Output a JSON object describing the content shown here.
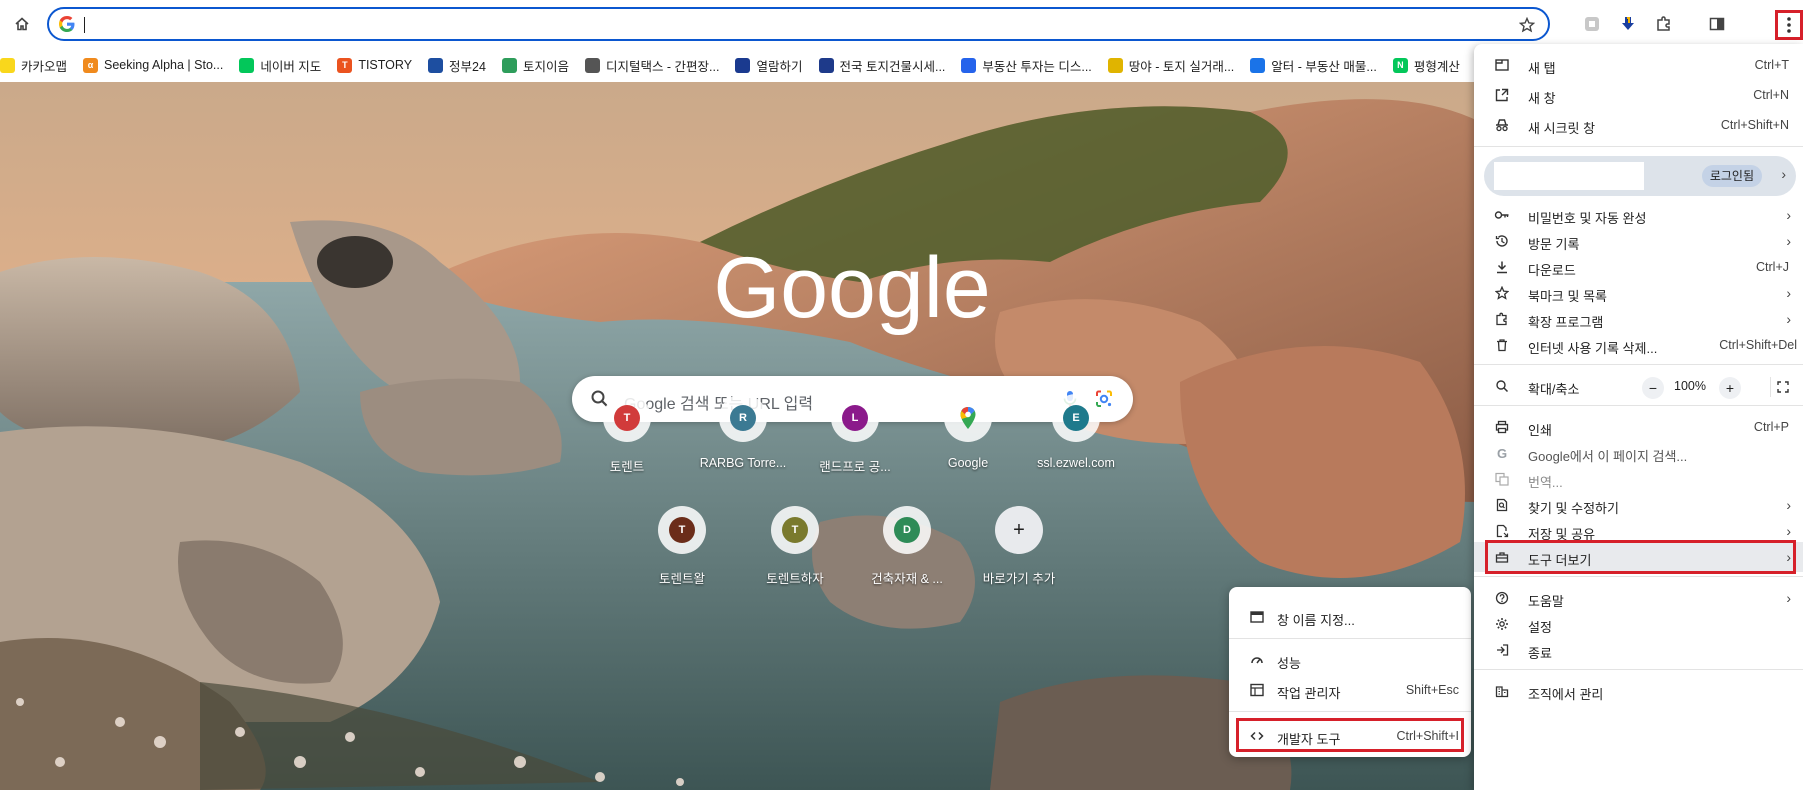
{
  "omnibox": {
    "value": ""
  },
  "bookmarks": [
    {
      "label": "카카오맵",
      "color": "#f9d71c",
      "glyph": ""
    },
    {
      "label": "Seeking Alpha | Sto...",
      "color": "#f08a1d",
      "glyph": "α"
    },
    {
      "label": "네이버 지도",
      "color": "#03c75a",
      "glyph": ""
    },
    {
      "label": "TISTORY",
      "color": "#eb531f",
      "glyph": "T"
    },
    {
      "label": "정부24",
      "color": "#1d4ea0",
      "glyph": ""
    },
    {
      "label": "토지이음",
      "color": "#2e9d5b",
      "glyph": ""
    },
    {
      "label": "디지털택스 - 간편장...",
      "color": "#555555",
      "glyph": ""
    },
    {
      "label": "열람하기",
      "color": "#1a3a8f",
      "glyph": ""
    },
    {
      "label": "전국 토지건물시세...",
      "color": "#1e3a8a",
      "glyph": ""
    },
    {
      "label": "부동산 투자는 디스...",
      "color": "#2563eb",
      "glyph": ""
    },
    {
      "label": "땅야 - 토지 실거래...",
      "color": "#e0b400",
      "glyph": ""
    },
    {
      "label": "알터 - 부동산 매물...",
      "color": "#1a73e8",
      "glyph": ""
    },
    {
      "label": "평형계산",
      "color": "#03c75a",
      "glyph": "N"
    }
  ],
  "ntp": {
    "logo_text": "Google",
    "search_placeholder": "Google 검색 또는 URL 입력",
    "shortcuts": [
      {
        "label": "토렌트",
        "letter": "T",
        "color": "#d13b3b"
      },
      {
        "label": "RARBG Torre...",
        "letter": "R",
        "color": "#3b7a93"
      },
      {
        "label": "랜드프로 공...",
        "letter": "L",
        "color": "#8b1a8b"
      },
      {
        "label": "Google",
        "letter": "",
        "color": "#ffffff"
      },
      {
        "label": "ssl.ezwel.com",
        "letter": "E",
        "color": "#1f7a8c"
      },
      {
        "label": "토렌트왈",
        "letter": "T",
        "color": "#6b2d1a"
      },
      {
        "label": "토렌트하자",
        "letter": "T",
        "color": "#7a7a2d"
      },
      {
        "label": "건축자재 & ...",
        "letter": "D",
        "color": "#2e8b57"
      },
      {
        "label": "바로가기 추가",
        "letter": "+",
        "color": "#e8eaed"
      }
    ]
  },
  "menu": {
    "new_tab": {
      "label": "새 탭",
      "shortcut": "Ctrl+T"
    },
    "new_window": {
      "label": "새 창",
      "shortcut": "Ctrl+N"
    },
    "incognito": {
      "label": "새 시크릿 창",
      "shortcut": "Ctrl+Shift+N"
    },
    "profile_status": "로그인됨",
    "passwords": {
      "label": "비밀번호 및 자동 완성"
    },
    "history": {
      "label": "방문 기록"
    },
    "downloads": {
      "label": "다운로드",
      "shortcut": "Ctrl+J"
    },
    "bookmarks": {
      "label": "북마크 및 목록"
    },
    "extensions": {
      "label": "확장 프로그램"
    },
    "clear_data": {
      "label": "인터넷 사용 기록 삭제...",
      "shortcut": "Ctrl+Shift+Del"
    },
    "zoom": {
      "label": "확대/축소",
      "minus": "−",
      "value": "100%",
      "plus": "+"
    },
    "print": {
      "label": "인쇄",
      "shortcut": "Ctrl+P"
    },
    "search_page": {
      "label": "Google에서 이 페이지 검색..."
    },
    "translate": {
      "label": "번역..."
    },
    "find_edit": {
      "label": "찾기 및 수정하기"
    },
    "save_share": {
      "label": "저장 및 공유"
    },
    "more_tools": {
      "label": "도구 더보기"
    },
    "help": {
      "label": "도움말"
    },
    "settings": {
      "label": "설정"
    },
    "exit": {
      "label": "종료"
    },
    "managed": {
      "label": "조직에서 관리"
    }
  },
  "submenu": {
    "name_window": {
      "label": "창 이름 지정..."
    },
    "performance": {
      "label": "성능"
    },
    "task_manager": {
      "label": "작업 관리자",
      "shortcut": "Shift+Esc"
    },
    "devtools": {
      "label": "개발자 도구",
      "shortcut": "Ctrl+Shift+I"
    }
  },
  "colors": {
    "accent": "#0b57d0",
    "highlight": "#d6202a"
  }
}
